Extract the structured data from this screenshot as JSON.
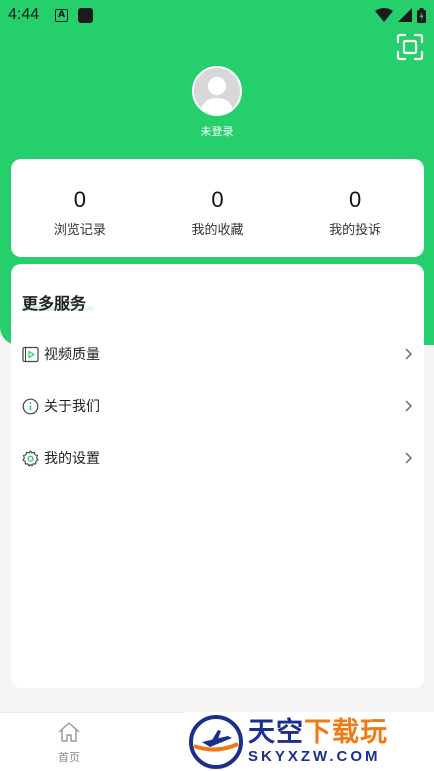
{
  "status_bar": {
    "time": "4:44",
    "badge": "A"
  },
  "profile": {
    "login_text": "未登录"
  },
  "stats": [
    {
      "count": "0",
      "label": "浏览记录"
    },
    {
      "count": "0",
      "label": "我的收藏"
    },
    {
      "count": "0",
      "label": "我的投诉"
    }
  ],
  "services": {
    "title": "更多服务",
    "items": [
      {
        "label": "视频质量",
        "icon": "video-quality-icon"
      },
      {
        "label": "关于我们",
        "icon": "info-icon"
      },
      {
        "label": "我的设置",
        "icon": "settings-gear-icon"
      }
    ]
  },
  "bottom_nav": {
    "home_label": "首页"
  },
  "watermark": {
    "title_part1": "天空",
    "title_part2": "下载玩",
    "url": "SKYXZW.COM"
  },
  "colors": {
    "brand_green": "#25cf6b",
    "watermark_blue": "#1c2f8f",
    "watermark_orange": "#f07a16"
  }
}
